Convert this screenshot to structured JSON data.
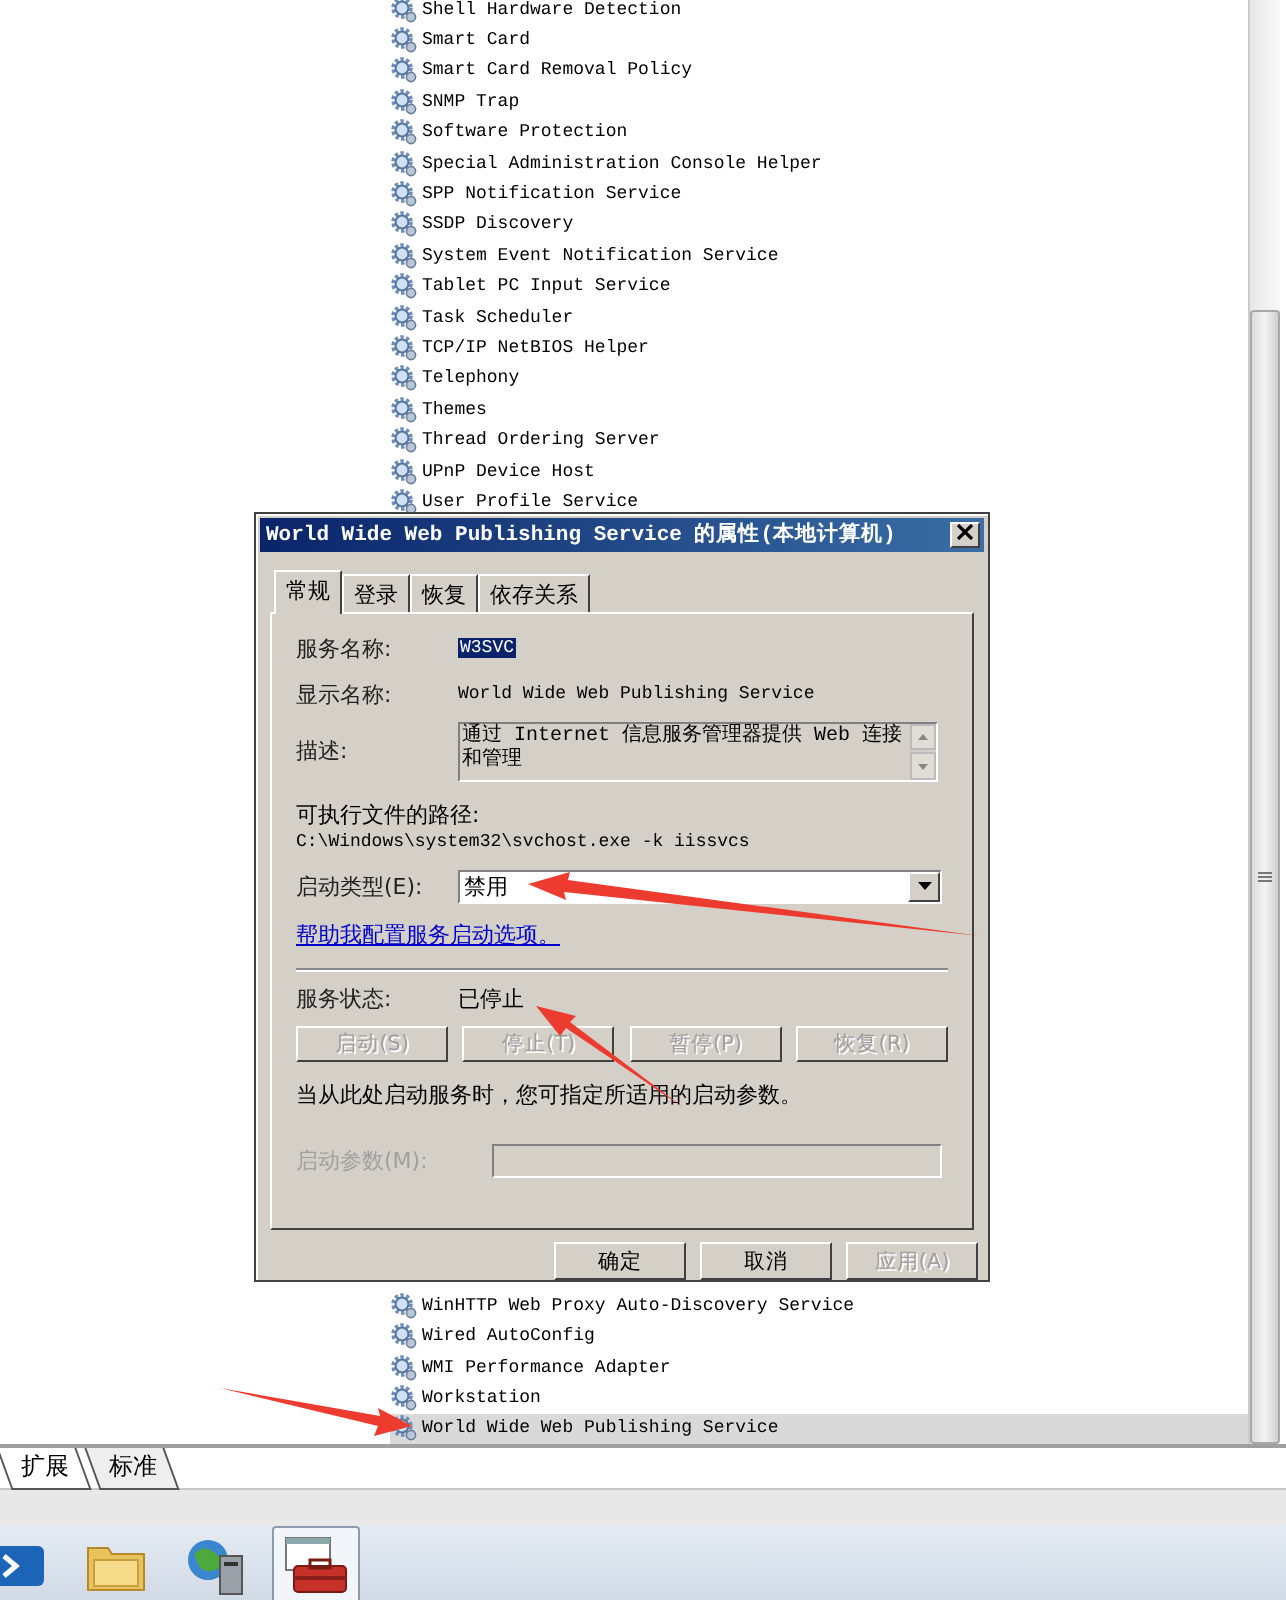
{
  "services_top": [
    {
      "name": "Shell Hardware Detection",
      "selected": false
    },
    {
      "name": "Smart Card",
      "selected": false
    },
    {
      "name": "Smart Card Removal Policy",
      "selected": false
    },
    {
      "name": "SNMP Trap",
      "selected": false
    },
    {
      "name": "Software Protection",
      "selected": false
    },
    {
      "name": "Special Administration Console Helper",
      "selected": false
    },
    {
      "name": "SPP Notification Service",
      "selected": false
    },
    {
      "name": "SSDP Discovery",
      "selected": false
    },
    {
      "name": "System Event Notification Service",
      "selected": false
    },
    {
      "name": "Tablet PC Input Service",
      "selected": false
    },
    {
      "name": "Task Scheduler",
      "selected": false
    },
    {
      "name": "TCP/IP NetBIOS Helper",
      "selected": false
    },
    {
      "name": "Telephony",
      "selected": false
    },
    {
      "name": "Themes",
      "selected": false
    },
    {
      "name": "Thread Ordering Server",
      "selected": false
    },
    {
      "name": "UPnP Device Host",
      "selected": false
    },
    {
      "name": "User Profile Service",
      "selected": false
    }
  ],
  "services_bottom": [
    {
      "name": "WinHTTP Web Proxy Auto-Discovery Service",
      "selected": false
    },
    {
      "name": "Wired AutoConfig",
      "selected": false
    },
    {
      "name": "WMI Performance Adapter",
      "selected": false
    },
    {
      "name": "Workstation",
      "selected": false
    },
    {
      "name": "World Wide Web Publishing Service",
      "selected": true
    }
  ],
  "dialog": {
    "title": "World Wide Web Publishing Service 的属性(本地计算机)",
    "tabs": [
      {
        "label": "常规",
        "selected": true
      },
      {
        "label": "登录",
        "selected": false
      },
      {
        "label": "恢复",
        "selected": false
      },
      {
        "label": "依存关系",
        "selected": false
      }
    ],
    "service_name_label": "服务名称:",
    "service_name": "W3SVC",
    "display_name_label": "显示名称:",
    "display_name": "World Wide Web Publishing Service",
    "description_label": "描述:",
    "description": "通过 Internet 信息服务管理器提供 Web 连接和管理",
    "path_label": "可执行文件的路径:",
    "path": "C:\\Windows\\system32\\svchost.exe -k iissvcs",
    "startup_type_label": "启动类型(E):",
    "startup_type": "禁用",
    "help_link": "帮助我配置服务启动选项。",
    "status_label": "服务状态:",
    "status": "已停止",
    "control_buttons": [
      {
        "label": "启动(S)",
        "disabled": true
      },
      {
        "label": "停止(T)",
        "disabled": true
      },
      {
        "label": "暂停(P)",
        "disabled": true
      },
      {
        "label": "恢复(R)",
        "disabled": true
      }
    ],
    "hint": "当从此处启动服务时，您可指定所适用的启动参数。",
    "parameters_label": "启动参数(M):",
    "parameters_disabled": true,
    "buttons": [
      {
        "label": "确定",
        "disabled": false
      },
      {
        "label": "取消",
        "disabled": false
      },
      {
        "label": "应用(A)",
        "disabled": true
      }
    ]
  },
  "view_tabs": [
    {
      "label": "扩展",
      "selected": true
    },
    {
      "label": "标准",
      "selected": false
    }
  ],
  "taskbar": [
    {
      "kind": "terminal",
      "active": false
    },
    {
      "kind": "folder",
      "active": false
    },
    {
      "kind": "server",
      "active": false
    },
    {
      "kind": "toolbox",
      "active": true
    }
  ]
}
